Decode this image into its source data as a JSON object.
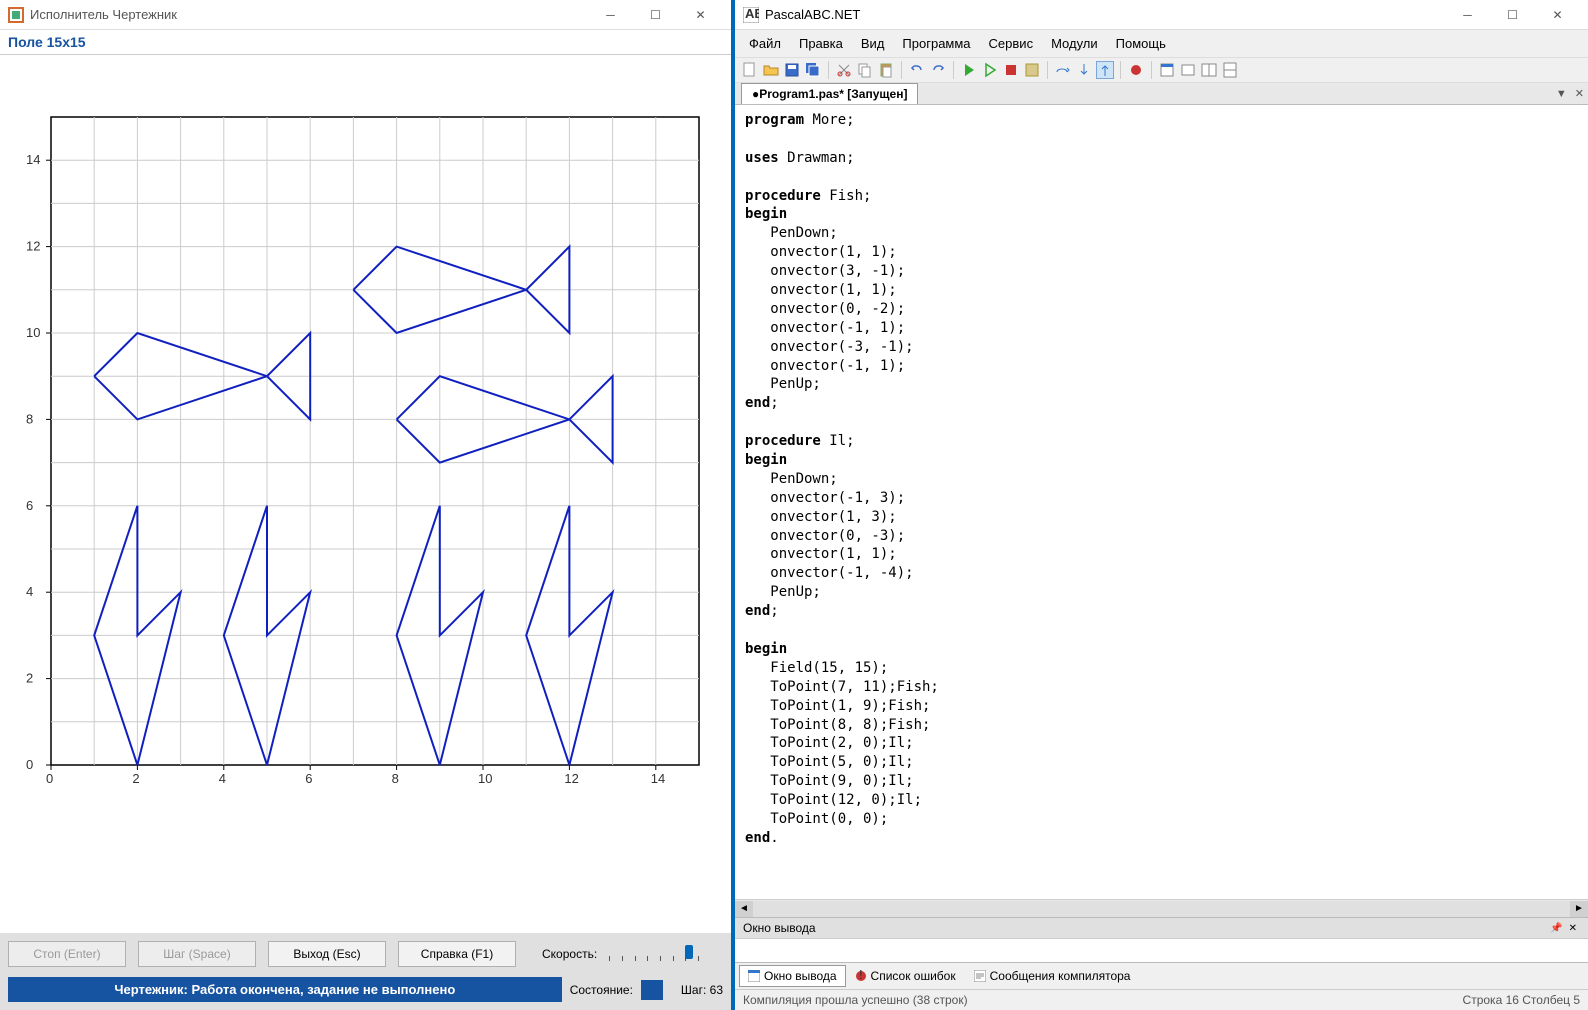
{
  "left": {
    "title": "Исполнитель Чертежник",
    "field_label": "Поле  15x15",
    "buttons": {
      "stop": "Стоп (Enter)",
      "step": "Шаг (Space)",
      "exit": "Выход (Esc)",
      "help": "Справка (F1)"
    },
    "speed_label": "Скорость:",
    "status_banner": "Чертежник: Работа окончена, задание не выполнено",
    "state_label": "Состояние:",
    "step_label": "Шаг: 63"
  },
  "right": {
    "title": "PascalABC.NET",
    "menu": [
      "Файл",
      "Правка",
      "Вид",
      "Программа",
      "Сервис",
      "Модули",
      "Помощь"
    ],
    "tab": "●Program1.pas* [Запущен]",
    "output_header": "Окно вывода",
    "bottom_tabs": {
      "out": "Окно вывода",
      "err": "Список ошибок",
      "comp": "Сообщения компилятора"
    },
    "status_compile": "Компиляция прошла успешно (38 строк)",
    "status_pos": "Строка  16   Столбец  5"
  },
  "code_lines": [
    {
      "t": "program",
      "k": 1
    },
    {
      "t": " More;"
    },
    {
      "br": 1
    },
    {
      "br": 1
    },
    {
      "t": "uses",
      "k": 1
    },
    {
      "t": " Drawman;"
    },
    {
      "br": 1
    },
    {
      "br": 1
    },
    {
      "t": "procedure",
      "k": 1
    },
    {
      "t": " Fish;"
    },
    {
      "br": 1
    },
    {
      "t": "begin",
      "k": 1
    },
    {
      "br": 1
    },
    {
      "t": "   PenDown;"
    },
    {
      "br": 1
    },
    {
      "t": "   onvector(1, 1);"
    },
    {
      "br": 1
    },
    {
      "t": "   onvector(3, -1);"
    },
    {
      "br": 1
    },
    {
      "t": "   onvector(1, 1);"
    },
    {
      "br": 1
    },
    {
      "t": "   onvector(0, -2);"
    },
    {
      "br": 1
    },
    {
      "t": "   onvector(-1, 1);"
    },
    {
      "br": 1
    },
    {
      "t": "   onvector(-3, -1);"
    },
    {
      "br": 1
    },
    {
      "t": "   onvector(-1, 1);"
    },
    {
      "br": 1
    },
    {
      "t": "   PenUp;"
    },
    {
      "br": 1
    },
    {
      "t": "end",
      "k": 1
    },
    {
      "t": ";"
    },
    {
      "br": 1
    },
    {
      "br": 1
    },
    {
      "t": "procedure",
      "k": 1
    },
    {
      "t": " Il;"
    },
    {
      "br": 1
    },
    {
      "t": "begin",
      "k": 1
    },
    {
      "br": 1
    },
    {
      "t": "   PenDown;"
    },
    {
      "br": 1
    },
    {
      "t": "   onvector(-1, 3);"
    },
    {
      "br": 1
    },
    {
      "t": "   onvector(1, 3);"
    },
    {
      "br": 1
    },
    {
      "t": "   onvector(0, -3);"
    },
    {
      "br": 1
    },
    {
      "t": "   onvector(1, 1);"
    },
    {
      "br": 1
    },
    {
      "t": "   onvector(-1, -4);"
    },
    {
      "br": 1
    },
    {
      "t": "   PenUp;"
    },
    {
      "br": 1
    },
    {
      "t": "end",
      "k": 1
    },
    {
      "t": ";"
    },
    {
      "br": 1
    },
    {
      "br": 1
    },
    {
      "t": "begin",
      "k": 1
    },
    {
      "br": 1
    },
    {
      "t": "   Field(15, 15);"
    },
    {
      "br": 1
    },
    {
      "t": "   ToPoint(7, 11);Fish;"
    },
    {
      "br": 1
    },
    {
      "t": "   ToPoint(1, 9);Fish;"
    },
    {
      "br": 1
    },
    {
      "t": "   ToPoint(8, 8);Fish;"
    },
    {
      "br": 1
    },
    {
      "t": "   ToPoint(2, 0);Il;"
    },
    {
      "br": 1
    },
    {
      "t": "   ToPoint(5, 0);Il;"
    },
    {
      "br": 1
    },
    {
      "t": "   ToPoint(9, 0);Il;"
    },
    {
      "br": 1
    },
    {
      "t": "   ToPoint(12, 0);Il;"
    },
    {
      "br": 1
    },
    {
      "t": "   ToPoint(0, 0);"
    },
    {
      "br": 1
    },
    {
      "t": "end",
      "k": 1
    },
    {
      "t": "."
    },
    {
      "br": 1
    }
  ],
  "chart_data": {
    "type": "line",
    "title": "Поле 15x15",
    "xlim": [
      0,
      15
    ],
    "ylim": [
      0,
      15
    ],
    "x_ticks": [
      0,
      2,
      4,
      6,
      8,
      10,
      12,
      14
    ],
    "y_ticks": [
      0,
      2,
      4,
      6,
      8,
      10,
      12,
      14
    ],
    "fish_vectors": [
      [
        1,
        1
      ],
      [
        3,
        -1
      ],
      [
        1,
        1
      ],
      [
        0,
        -2
      ],
      [
        -1,
        1
      ],
      [
        -3,
        -1
      ],
      [
        -1,
        1
      ]
    ],
    "il_vectors": [
      [
        -1,
        3
      ],
      [
        1,
        3
      ],
      [
        0,
        -3
      ],
      [
        1,
        1
      ],
      [
        -1,
        -4
      ]
    ],
    "fish_starts": [
      [
        7,
        11
      ],
      [
        1,
        9
      ],
      [
        8,
        8
      ]
    ],
    "il_starts": [
      [
        2,
        0
      ],
      [
        5,
        0
      ],
      [
        9,
        0
      ],
      [
        12,
        0
      ]
    ]
  }
}
